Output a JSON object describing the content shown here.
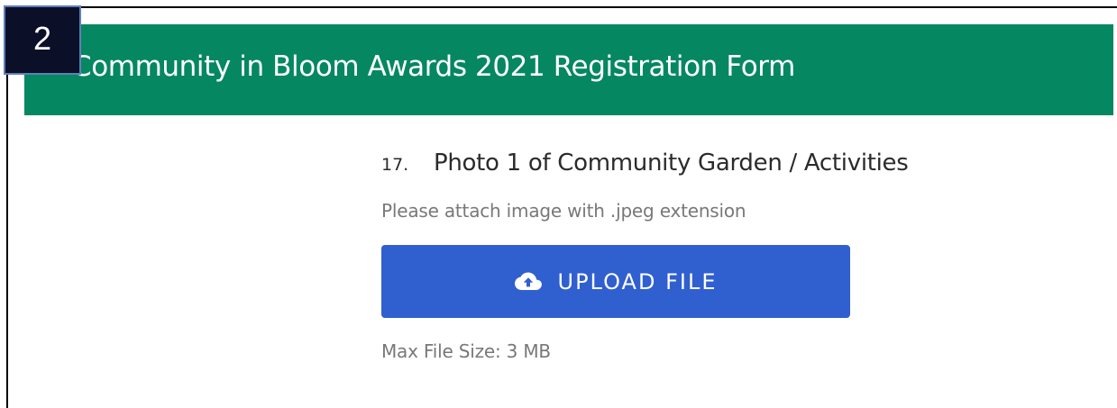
{
  "step_badge": "2",
  "header": {
    "title": "Community in Bloom Awards 2021 Registration Form"
  },
  "question": {
    "number": "17.",
    "title": "Photo 1 of Community Garden / Activities",
    "hint": "Please attach image with .jpeg extension",
    "upload_button_label": "UPLOAD FILE",
    "upload_icon": "cloud-upload-icon",
    "max_file_size": "Max File Size: 3 MB"
  },
  "colors": {
    "header_background": "#058762",
    "button_background": "#305fcf",
    "badge_background": "#0b1028"
  }
}
